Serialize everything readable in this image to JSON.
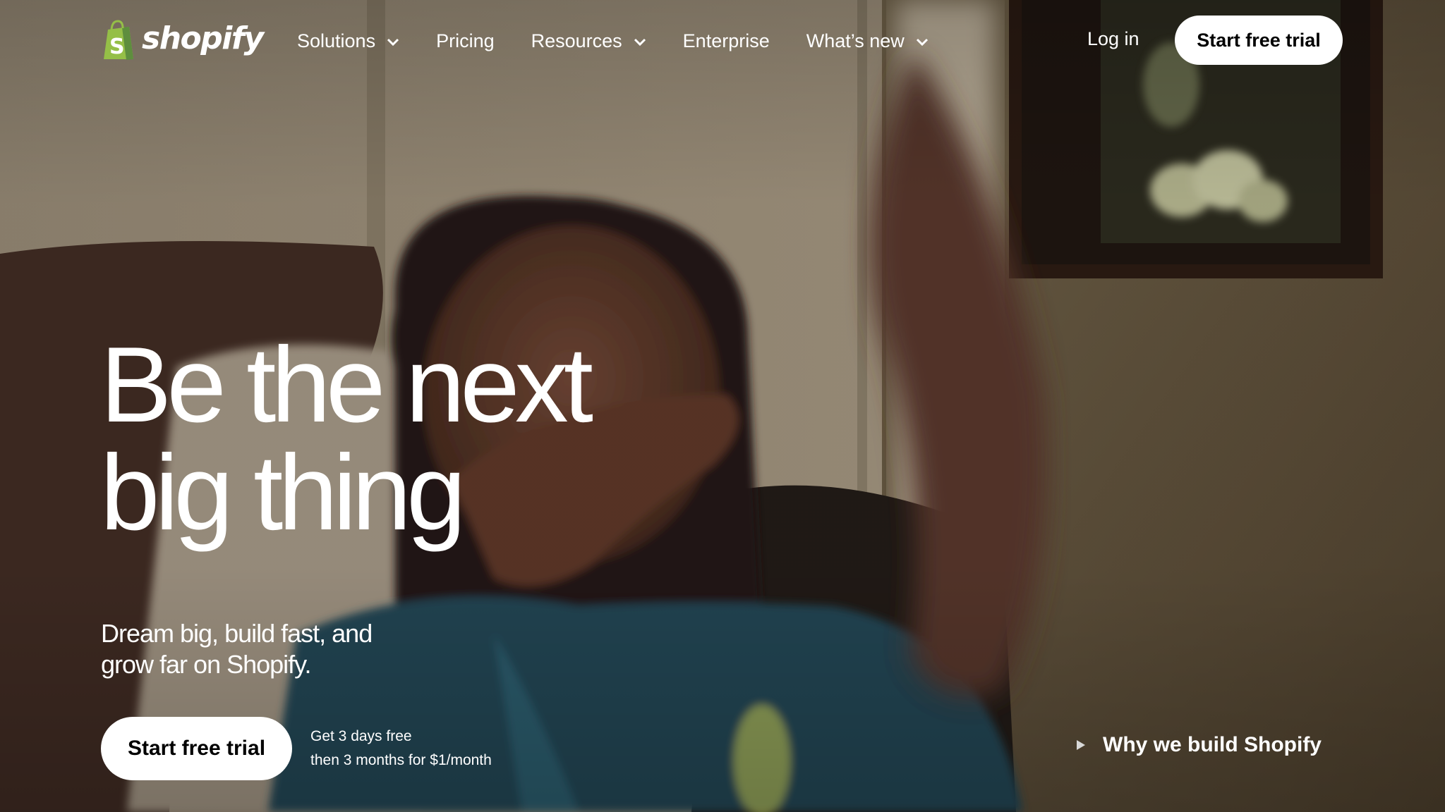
{
  "brand": {
    "name": "shopify",
    "accent": "#95bf47",
    "accent_dark": "#5e8e3e"
  },
  "nav": {
    "items": [
      {
        "label": "Solutions",
        "has_dropdown": true
      },
      {
        "label": "Pricing",
        "has_dropdown": false
      },
      {
        "label": "Resources",
        "has_dropdown": true
      },
      {
        "label": "Enterprise",
        "has_dropdown": false
      },
      {
        "label": "What’s new",
        "has_dropdown": true
      }
    ],
    "login_label": "Log in",
    "cta_label": "Start free trial"
  },
  "hero": {
    "headline_lines": [
      "Be the next",
      "big thing"
    ],
    "subhead_lines": [
      "Dream big, build fast, and",
      "grow far on Shopify."
    ],
    "cta_label": "Start free trial",
    "offer_lines": [
      "Get 3 days free",
      "then 3 months for $1/month"
    ],
    "video_link_label": "Why we build Shopify"
  },
  "icons": {
    "logo": "shopping-bag-icon",
    "dropdown": "chevron-down-icon",
    "video": "play-icon"
  }
}
